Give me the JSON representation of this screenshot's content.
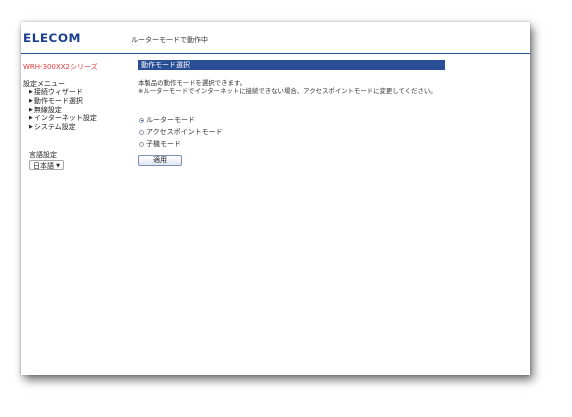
{
  "header": {
    "logo": "ELECOM",
    "mode_status": "ルーターモードで動作中"
  },
  "sidebar": {
    "series_name": "WRH-300XX2シリーズ",
    "menu_title": "設定メニュー",
    "items": [
      {
        "label": "接続ウィザード"
      },
      {
        "label": "動作モード選択"
      },
      {
        "label": "無線設定"
      },
      {
        "label": "インターネット設定"
      },
      {
        "label": "システム設定"
      }
    ],
    "language_title": "言語設定",
    "language_selected": "日本語"
  },
  "main": {
    "section_title": "動作モード選択",
    "description_line1": "本製品の動作モードを選択できます。",
    "description_line2": "※ルーターモードでインターネットに接続できない場合、アクセスポイントモードに変更してください。",
    "modes": [
      {
        "label": "ルーターモード",
        "checked": true
      },
      {
        "label": "アクセスポイントモード",
        "checked": false
      },
      {
        "label": "子機モード",
        "checked": false
      }
    ],
    "apply_label": "適用"
  },
  "colors": {
    "brand": "#1a3f8f",
    "accent_bar": "#2a4e95",
    "series_name": "#e03a3a"
  }
}
